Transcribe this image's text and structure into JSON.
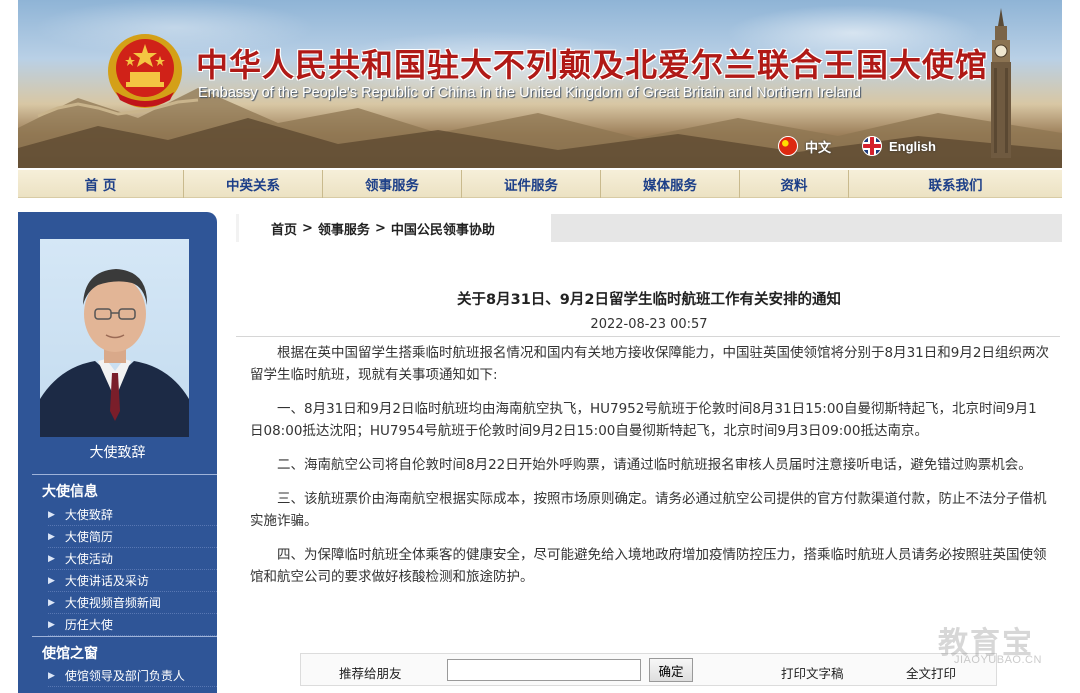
{
  "header": {
    "title_cn": "中华人民共和国驻大不列颠及北爱尔兰联合王国大使馆",
    "title_en": "Embassy of the People's Republic of China in the United Kingdom of Great Britain and Northern Ireland",
    "lang_cn": "中文",
    "lang_en": "English"
  },
  "nav": {
    "items": [
      {
        "label": "首 页"
      },
      {
        "label": "中英关系"
      },
      {
        "label": "领事服务"
      },
      {
        "label": "证件服务"
      },
      {
        "label": "媒体服务"
      },
      {
        "label": "资料"
      },
      {
        "label": "联系我们"
      }
    ]
  },
  "sidebar": {
    "photo_caption": "大使致辞",
    "section1": {
      "heading": "大使信息",
      "links": [
        "大使致辞",
        "大使简历",
        "大使活动",
        "大使讲话及采访",
        "大使视频音频新闻",
        "历任大使"
      ]
    },
    "section2": {
      "heading": "使馆之窗",
      "links": [
        "使馆领导及部门负责人"
      ]
    }
  },
  "breadcrumb": {
    "home": "首页",
    "level1": "领事服务",
    "level2": "中国公民领事协助",
    "separator": ">"
  },
  "article": {
    "title": "关于8月31日、9月2日留学生临时航班工作有关安排的通知",
    "date": "2022-08-23 00:57",
    "paragraphs": [
      "根据在英中国留学生搭乘临时航班报名情况和国内有关地方接收保障能力，中国驻英国使领馆将分别于8月31日和9月2日组织两次留学生临时航班，现就有关事项通知如下:",
      "一、8月31日和9月2日临时航班均由海南航空执飞，HU7952号航班于伦敦时间8月31日15:00自曼彻斯特起飞，北京时间9月1日08:00抵达沈阳；HU7954号航班于伦敦时间9月2日15:00自曼彻斯特起飞，北京时间9月3日09:00抵达南京。",
      "二、海南航空公司将自伦敦时间8月22日开始外呼购票，请通过临时航班报名审核人员届时注意接听电话，避免错过购票机会。",
      "三、该航班票价由海南航空根据实际成本，按照市场原则确定。请务必通过航空公司提供的官方付款渠道付款，防止不法分子借机实施诈骗。",
      "四、为保障临时航班全体乘客的健康安全，尽可能避免给入境地政府增加疫情防控压力，搭乘临时航班人员请务必按照驻英国使领馆和航空公司的要求做好核酸检测和旅途防护。"
    ]
  },
  "toolbar": {
    "recommend_label": "推荐给朋友",
    "input_value": "",
    "ok_label": "确定",
    "print_text": "打印文字稿",
    "print_all": "全文打印"
  },
  "watermark": {
    "cn": "教育宝",
    "en": "JIAOYUBAO.CN"
  },
  "colors": {
    "sidebar_bg": "#2f5597",
    "nav_text": "#1d3f88",
    "title_red": "#b01916"
  }
}
